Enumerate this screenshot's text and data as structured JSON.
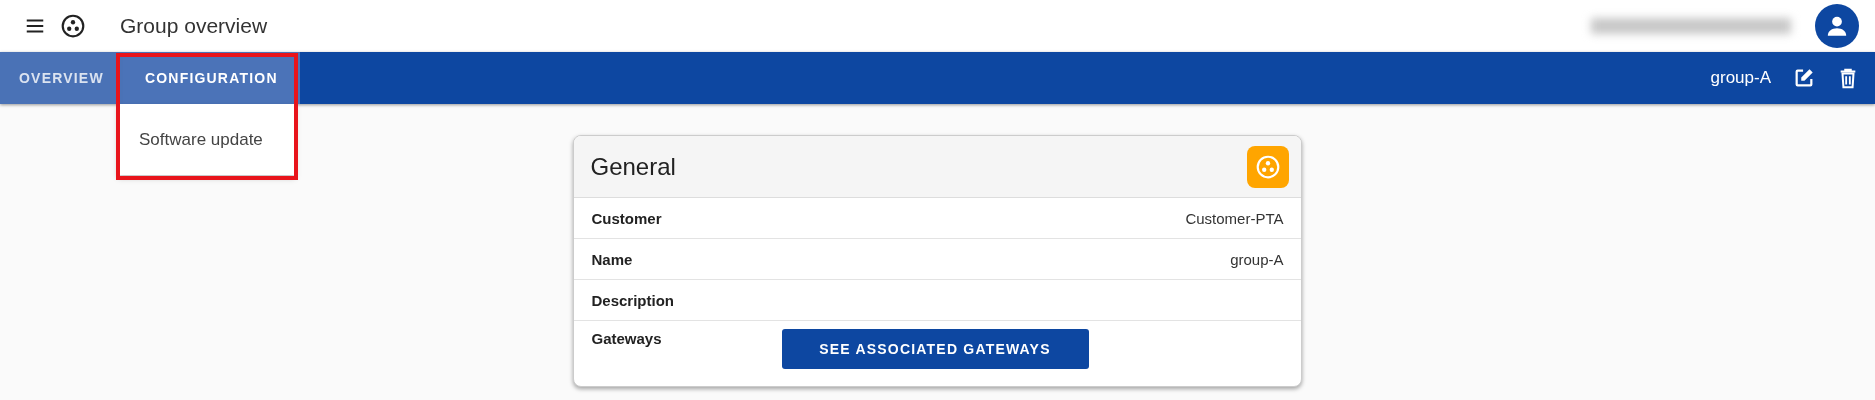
{
  "header": {
    "title": "Group overview"
  },
  "tabs": [
    {
      "label": "OVERVIEW",
      "selected": false
    },
    {
      "label": "CONFIGURATION",
      "selected": true
    }
  ],
  "menu": {
    "items": [
      "Software update"
    ]
  },
  "toolbar": {
    "group_name": "group-A"
  },
  "card": {
    "title": "General",
    "rows": [
      {
        "label": "Customer",
        "value": "Customer-PTA"
      },
      {
        "label": "Name",
        "value": "group-A"
      },
      {
        "label": "Description"
      },
      {
        "label": "Gateways",
        "button": "SEE ASSOCIATED GATEWAYS"
      }
    ]
  }
}
